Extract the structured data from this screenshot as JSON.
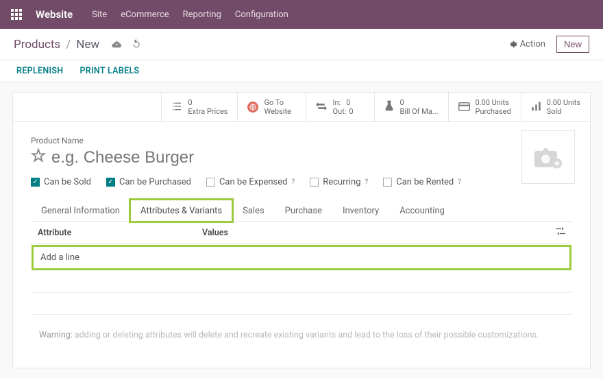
{
  "topbar": {
    "brand": "Website",
    "menu": [
      "Site",
      "eCommerce",
      "Reporting",
      "Configuration"
    ]
  },
  "breadcrumb": {
    "root": "Products",
    "current": "New"
  },
  "actions": {
    "action": "Action",
    "new": "New"
  },
  "actionbar": {
    "replenish": "REPLENISH",
    "print": "PRINT LABELS"
  },
  "stats": {
    "extra": {
      "n": "0",
      "label": "Extra Prices"
    },
    "goto": {
      "l1": "Go To",
      "l2": "Website"
    },
    "inout": {
      "in_l": "In:",
      "in_v": "0",
      "out_l": "Out:",
      "out_v": "0"
    },
    "bom": {
      "n": "0",
      "label": "Bill Of Ma..."
    },
    "purchased": {
      "n": "0.00 Units",
      "label": "Purchased"
    },
    "sold": {
      "n": "0.00 Units",
      "label": "Sold"
    }
  },
  "form": {
    "name_label": "Product Name",
    "name_placeholder": "e.g. Cheese Burger",
    "checks": {
      "sold": "Can be Sold",
      "purchased": "Can be Purchased",
      "expensed": "Can be Expensed",
      "recurring": "Recurring",
      "rented": "Can be Rented"
    }
  },
  "tabs": [
    "General Information",
    "Attributes & Variants",
    "Sales",
    "Purchase",
    "Inventory",
    "Accounting"
  ],
  "grid": {
    "col1": "Attribute",
    "col2": "Values",
    "add": "Add a line"
  },
  "warning": {
    "label": "Warning:",
    "text": " adding or deleting attributes will delete and recreate existing variants and lead to the loss of their possible customizations."
  }
}
